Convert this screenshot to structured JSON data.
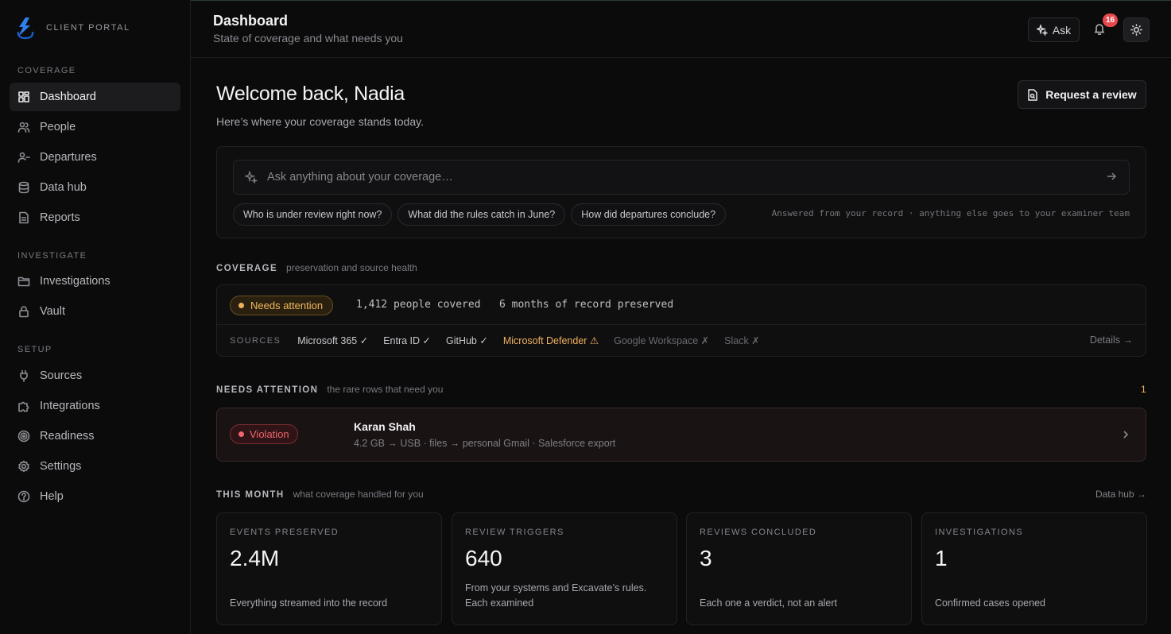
{
  "brand": {
    "name": "CLIENT PORTAL"
  },
  "sidebar": {
    "sections": [
      {
        "title": "COVERAGE",
        "items": [
          {
            "label": "Dashboard",
            "icon": "dashboard-icon"
          },
          {
            "label": "People",
            "icon": "people-icon"
          },
          {
            "label": "Departures",
            "icon": "departures-icon"
          },
          {
            "label": "Data hub",
            "icon": "database-icon"
          },
          {
            "label": "Reports",
            "icon": "report-icon"
          }
        ]
      },
      {
        "title": "INVESTIGATE",
        "items": [
          {
            "label": "Investigations",
            "icon": "folder-icon"
          },
          {
            "label": "Vault",
            "icon": "lock-icon"
          }
        ]
      },
      {
        "title": "SETUP",
        "items": [
          {
            "label": "Sources",
            "icon": "plug-icon"
          },
          {
            "label": "Integrations",
            "icon": "puzzle-icon"
          },
          {
            "label": "Readiness",
            "icon": "target-icon"
          },
          {
            "label": "Settings",
            "icon": "gear-icon"
          },
          {
            "label": "Help",
            "icon": "help-icon"
          }
        ]
      }
    ],
    "active": "Dashboard"
  },
  "header": {
    "title": "Dashboard",
    "subtitle": "State of coverage and what needs you",
    "ask_label": "Ask",
    "notification_count": "16"
  },
  "main": {
    "welcome": "Welcome back, Nadia",
    "welcome_sub": "Here’s where your coverage stands today.",
    "request_review_label": "Request a review",
    "ask": {
      "placeholder": "Ask anything about your coverage…",
      "suggestions": [
        "Who is under review right now?",
        "What did the rules catch in June?",
        "How did departures conclude?"
      ],
      "note": "Answered from your record · anything else goes to your examiner team"
    },
    "coverage": {
      "title": "COVERAGE",
      "desc": "preservation and source health",
      "status": "Needs attention",
      "people_covered": "1,412 people covered",
      "months_preserved": "6 months of record preserved",
      "sources_label": "SOURCES",
      "sources": [
        {
          "label": "Microsoft 365 ✓",
          "state": "ok"
        },
        {
          "label": "Entra ID ✓",
          "state": "ok"
        },
        {
          "label": "GitHub ✓",
          "state": "ok"
        },
        {
          "label": "Microsoft Defender ⚠",
          "state": "warn"
        },
        {
          "label": "Google Workspace ✗",
          "state": "off"
        },
        {
          "label": "Slack ✗",
          "state": "off"
        }
      ],
      "details_label": "Details →"
    },
    "needs_attention": {
      "title": "NEEDS ATTENTION",
      "desc": "the rare rows that need you",
      "count": "1",
      "rows": [
        {
          "badge": "Violation",
          "name": "Karan Shah",
          "detail": "4.2 GB → USB · files → personal Gmail · Salesforce export"
        }
      ]
    },
    "this_month": {
      "title": "THIS MONTH",
      "desc": "what coverage handled for you",
      "link": "Data hub →",
      "metrics": [
        {
          "label": "EVENTS PRESERVED",
          "value": "2.4M",
          "desc": "Everything streamed into the record"
        },
        {
          "label": "REVIEW TRIGGERS",
          "value": "640",
          "desc": "From your systems and Excavate’s rules. Each examined"
        },
        {
          "label": "REVIEWS CONCLUDED",
          "value": "3",
          "desc": "Each one a verdict, not an alert"
        },
        {
          "label": "INVESTIGATIONS",
          "value": "1",
          "desc": "Confirmed cases opened"
        }
      ]
    }
  },
  "colors": {
    "accent_blue": "#2f80ed",
    "warn": "#f0b060",
    "danger": "#e5484d"
  }
}
